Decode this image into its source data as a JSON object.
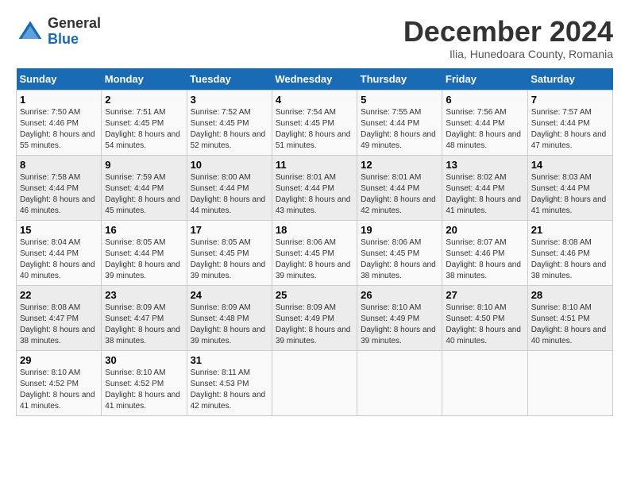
{
  "logo": {
    "line1": "General",
    "line2": "Blue"
  },
  "title": "December 2024",
  "subtitle": "Ilia, Hunedoara County, Romania",
  "days_of_week": [
    "Sunday",
    "Monday",
    "Tuesday",
    "Wednesday",
    "Thursday",
    "Friday",
    "Saturday"
  ],
  "weeks": [
    [
      {
        "day": "1",
        "sunrise": "7:50 AM",
        "sunset": "4:46 PM",
        "daylight": "8 hours and 55 minutes."
      },
      {
        "day": "2",
        "sunrise": "7:51 AM",
        "sunset": "4:45 PM",
        "daylight": "8 hours and 54 minutes."
      },
      {
        "day": "3",
        "sunrise": "7:52 AM",
        "sunset": "4:45 PM",
        "daylight": "8 hours and 52 minutes."
      },
      {
        "day": "4",
        "sunrise": "7:54 AM",
        "sunset": "4:45 PM",
        "daylight": "8 hours and 51 minutes."
      },
      {
        "day": "5",
        "sunrise": "7:55 AM",
        "sunset": "4:44 PM",
        "daylight": "8 hours and 49 minutes."
      },
      {
        "day": "6",
        "sunrise": "7:56 AM",
        "sunset": "4:44 PM",
        "daylight": "8 hours and 48 minutes."
      },
      {
        "day": "7",
        "sunrise": "7:57 AM",
        "sunset": "4:44 PM",
        "daylight": "8 hours and 47 minutes."
      }
    ],
    [
      {
        "day": "8",
        "sunrise": "7:58 AM",
        "sunset": "4:44 PM",
        "daylight": "8 hours and 46 minutes."
      },
      {
        "day": "9",
        "sunrise": "7:59 AM",
        "sunset": "4:44 PM",
        "daylight": "8 hours and 45 minutes."
      },
      {
        "day": "10",
        "sunrise": "8:00 AM",
        "sunset": "4:44 PM",
        "daylight": "8 hours and 44 minutes."
      },
      {
        "day": "11",
        "sunrise": "8:01 AM",
        "sunset": "4:44 PM",
        "daylight": "8 hours and 43 minutes."
      },
      {
        "day": "12",
        "sunrise": "8:01 AM",
        "sunset": "4:44 PM",
        "daylight": "8 hours and 42 minutes."
      },
      {
        "day": "13",
        "sunrise": "8:02 AM",
        "sunset": "4:44 PM",
        "daylight": "8 hours and 41 minutes."
      },
      {
        "day": "14",
        "sunrise": "8:03 AM",
        "sunset": "4:44 PM",
        "daylight": "8 hours and 41 minutes."
      }
    ],
    [
      {
        "day": "15",
        "sunrise": "8:04 AM",
        "sunset": "4:44 PM",
        "daylight": "8 hours and 40 minutes."
      },
      {
        "day": "16",
        "sunrise": "8:05 AM",
        "sunset": "4:44 PM",
        "daylight": "8 hours and 39 minutes."
      },
      {
        "day": "17",
        "sunrise": "8:05 AM",
        "sunset": "4:45 PM",
        "daylight": "8 hours and 39 minutes."
      },
      {
        "day": "18",
        "sunrise": "8:06 AM",
        "sunset": "4:45 PM",
        "daylight": "8 hours and 39 minutes."
      },
      {
        "day": "19",
        "sunrise": "8:06 AM",
        "sunset": "4:45 PM",
        "daylight": "8 hours and 38 minutes."
      },
      {
        "day": "20",
        "sunrise": "8:07 AM",
        "sunset": "4:46 PM",
        "daylight": "8 hours and 38 minutes."
      },
      {
        "day": "21",
        "sunrise": "8:08 AM",
        "sunset": "4:46 PM",
        "daylight": "8 hours and 38 minutes."
      }
    ],
    [
      {
        "day": "22",
        "sunrise": "8:08 AM",
        "sunset": "4:47 PM",
        "daylight": "8 hours and 38 minutes."
      },
      {
        "day": "23",
        "sunrise": "8:09 AM",
        "sunset": "4:47 PM",
        "daylight": "8 hours and 38 minutes."
      },
      {
        "day": "24",
        "sunrise": "8:09 AM",
        "sunset": "4:48 PM",
        "daylight": "8 hours and 39 minutes."
      },
      {
        "day": "25",
        "sunrise": "8:09 AM",
        "sunset": "4:49 PM",
        "daylight": "8 hours and 39 minutes."
      },
      {
        "day": "26",
        "sunrise": "8:10 AM",
        "sunset": "4:49 PM",
        "daylight": "8 hours and 39 minutes."
      },
      {
        "day": "27",
        "sunrise": "8:10 AM",
        "sunset": "4:50 PM",
        "daylight": "8 hours and 40 minutes."
      },
      {
        "day": "28",
        "sunrise": "8:10 AM",
        "sunset": "4:51 PM",
        "daylight": "8 hours and 40 minutes."
      }
    ],
    [
      {
        "day": "29",
        "sunrise": "8:10 AM",
        "sunset": "4:52 PM",
        "daylight": "8 hours and 41 minutes."
      },
      {
        "day": "30",
        "sunrise": "8:10 AM",
        "sunset": "4:52 PM",
        "daylight": "8 hours and 41 minutes."
      },
      {
        "day": "31",
        "sunrise": "8:11 AM",
        "sunset": "4:53 PM",
        "daylight": "8 hours and 42 minutes."
      },
      null,
      null,
      null,
      null
    ]
  ]
}
